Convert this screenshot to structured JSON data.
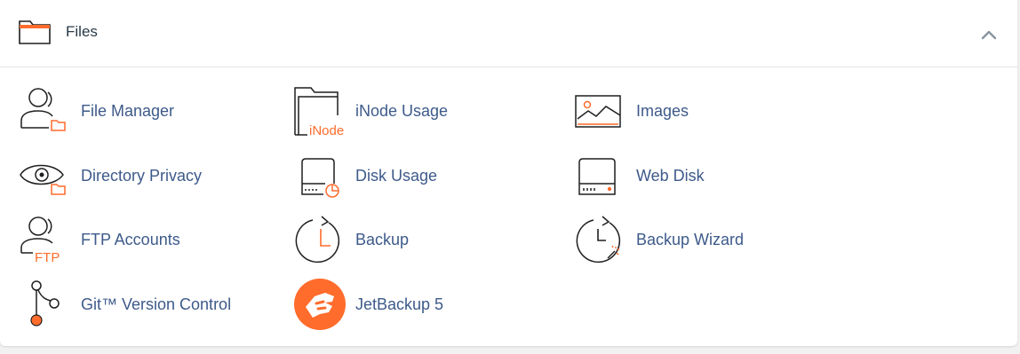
{
  "section": {
    "title": "Files",
    "accent_color": "#ff6c2c",
    "link_color": "#3d5a8a",
    "header_icon": "folder-icon",
    "toggle_icon": "chevron-up-icon"
  },
  "items": [
    {
      "label": "File Manager",
      "icon": "file-manager-icon"
    },
    {
      "label": "iNode Usage",
      "icon": "inode-usage-icon",
      "icon_text": "iNode"
    },
    {
      "label": "Images",
      "icon": "images-icon"
    },
    {
      "label": "Directory Privacy",
      "icon": "directory-privacy-icon"
    },
    {
      "label": "Disk Usage",
      "icon": "disk-usage-icon"
    },
    {
      "label": "Web Disk",
      "icon": "web-disk-icon"
    },
    {
      "label": "FTP Accounts",
      "icon": "ftp-accounts-icon",
      "icon_text": "FTP"
    },
    {
      "label": "Backup",
      "icon": "backup-icon"
    },
    {
      "label": "Backup Wizard",
      "icon": "backup-wizard-icon"
    },
    {
      "label": "Git™ Version Control",
      "icon": "git-version-control-icon"
    },
    {
      "label": "JetBackup 5",
      "icon": "jetbackup-icon"
    }
  ]
}
